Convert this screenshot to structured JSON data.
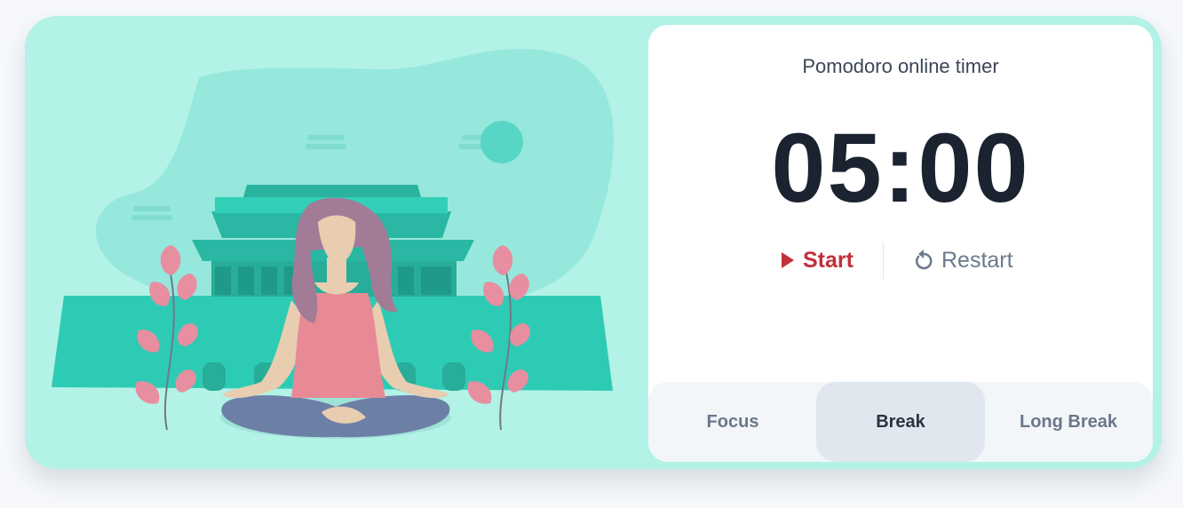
{
  "illustration": {
    "description_icon": "meditation-temple-illustration"
  },
  "timer": {
    "title": "Pomodoro online timer",
    "time": "05:00",
    "start_label": "Start",
    "restart_label": "Restart"
  },
  "tabs": [
    {
      "label": "Focus",
      "active": false
    },
    {
      "label": "Break",
      "active": true
    },
    {
      "label": "Long Break",
      "active": false
    }
  ],
  "colors": {
    "card_bg": "#b3f2e6",
    "temple": "#2ecbb4",
    "start": "#c0313a",
    "restart": "#6c7a8d"
  }
}
